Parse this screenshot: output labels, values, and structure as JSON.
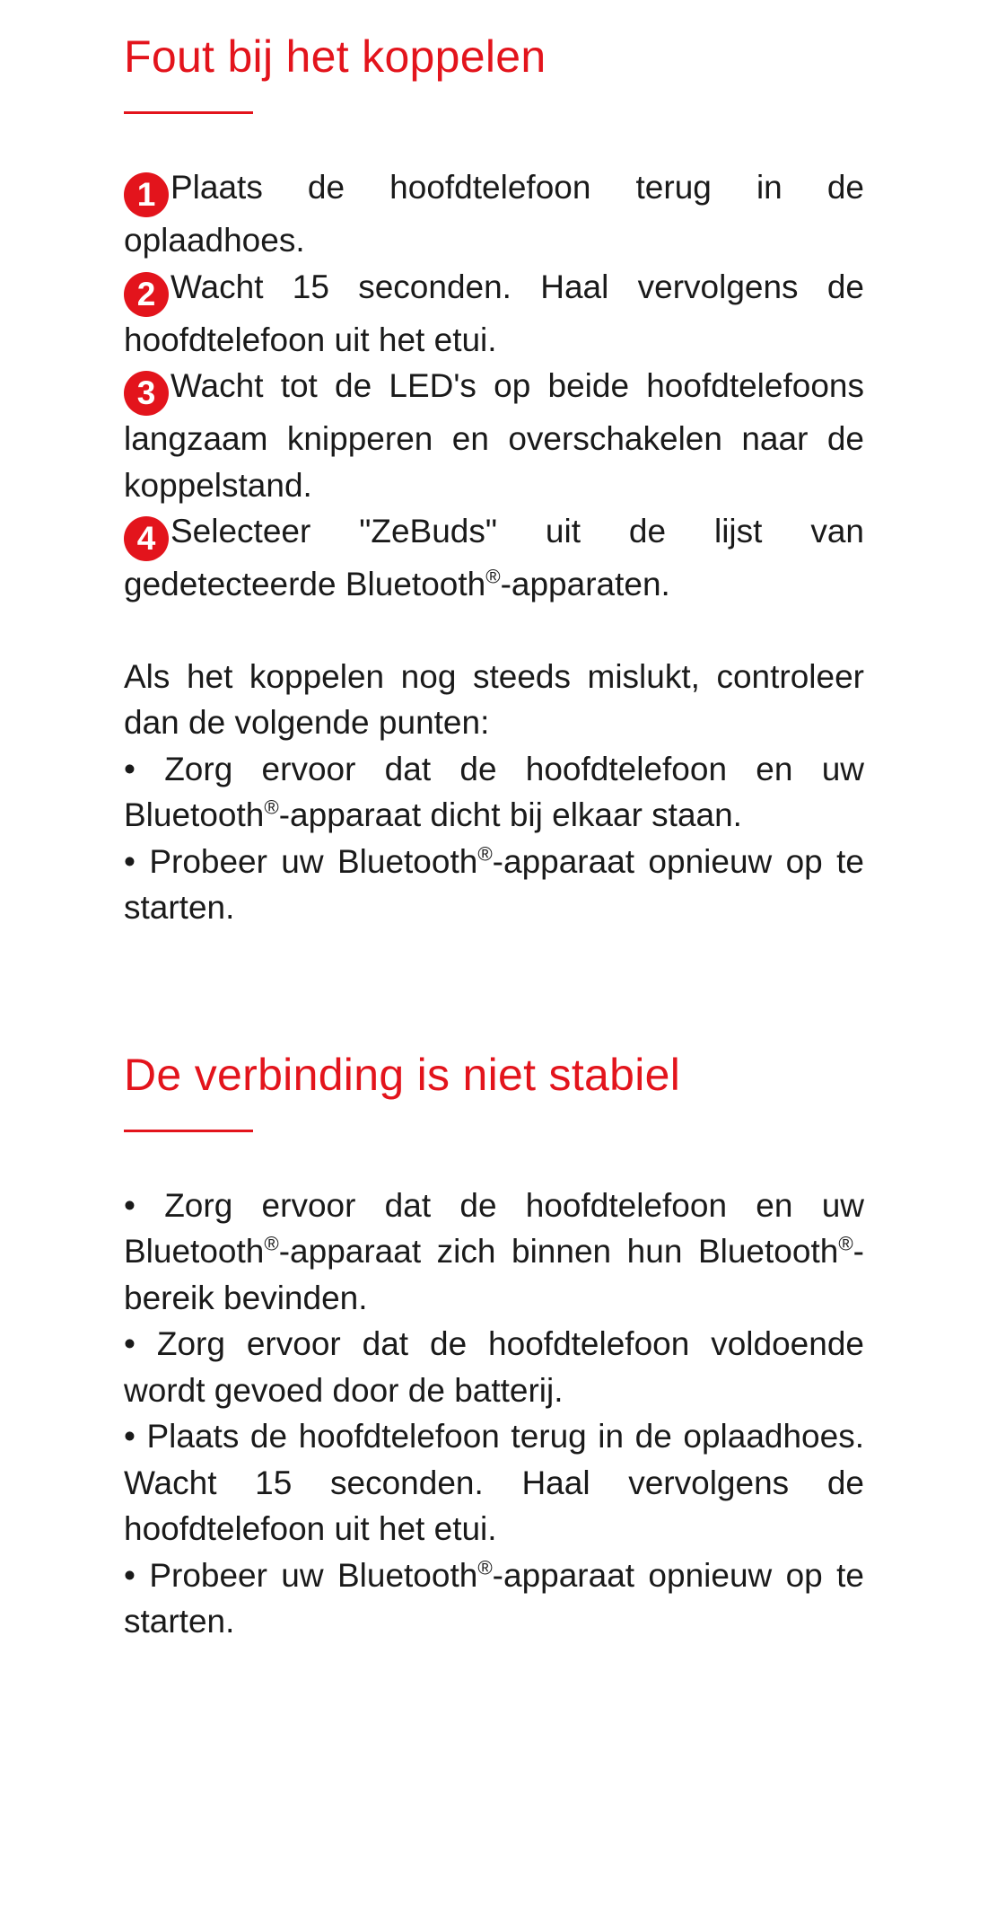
{
  "section1": {
    "title": "Fout bij het koppelen",
    "steps": [
      {
        "number": "1",
        "text": "Plaats de hoofdtelefoon terug in de oplaadhoes."
      },
      {
        "number": "2",
        "text": "Wacht 15 seconden. Haal vervolgens de hoofdtelefoon uit het etui."
      },
      {
        "number": "3",
        "text": "Wacht tot de LED's op beide hoofdtelefoons langzaam knipperen en overschakelen naar de koppelstand."
      },
      {
        "number": "4",
        "text_before": "Selecteer \"ZeBuds\" uit de lijst van gedetecteerde Bluetooth",
        "reg": "®",
        "text_after": "-apparaten."
      }
    ],
    "intro": "Als het koppelen nog steeds mislukt, controleer dan de volgende punten:",
    "bullets": [
      {
        "a": "• Zorg ervoor dat de hoofdtelefoon en uw Bluetooth",
        "reg": "®",
        "b": "-apparaat dicht bij elkaar staan."
      },
      {
        "a": "• Probeer uw Bluetooth",
        "reg": "®",
        "b": "-apparaat opnieuw op te starten."
      }
    ]
  },
  "section2": {
    "title": "De verbinding is niet stabiel",
    "bullets": [
      {
        "a": "• Zorg ervoor dat de hoofdtelefoon en uw Bluetooth",
        "reg": "®",
        "b": "-apparaat zich binnen hun Bluetooth",
        "reg2": "®",
        "c": "-bereik bevinden."
      },
      {
        "a": "• Zorg ervoor dat de hoofdtelefoon voldoende wordt gevoed door de batterij."
      },
      {
        "a": "• Plaats de hoofdtelefoon terug in de oplaadhoes. Wacht 15 seconden. Haal vervolgens de hoofdtelefoon uit het etui."
      },
      {
        "a": "• Probeer uw Bluetooth",
        "reg": "®",
        "b": "-apparaat opnieuw op te starten."
      }
    ]
  },
  "colors": {
    "accent": "#e3141c",
    "text": "#1a1a1a",
    "background": "#ffffff"
  }
}
